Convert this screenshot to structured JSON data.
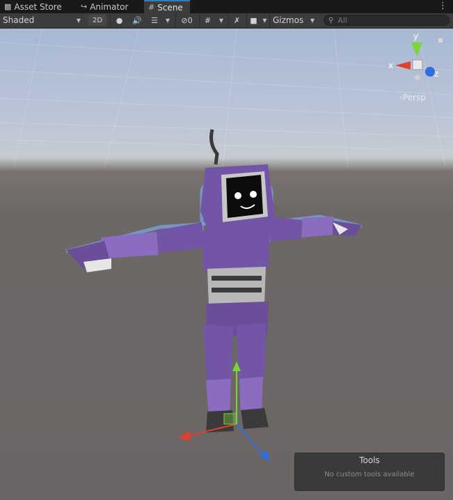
{
  "tabs": [
    {
      "label": "Asset Store",
      "icon": "shopping-bag-icon"
    },
    {
      "label": "Animator",
      "icon": "animator-icon"
    },
    {
      "label": "Scene",
      "icon": "scene-grid-icon",
      "active": true
    }
  ],
  "toolbar": {
    "draw_mode": "Shaded",
    "mode_2d": "2D",
    "hidden_count": "0",
    "gizmos_label": "Gizmos",
    "search_placeholder": "All"
  },
  "scene_gizmo": {
    "axis_y": "y",
    "axis_x": "x",
    "axis_z": "z",
    "projection": "Persp"
  },
  "tools_overlay": {
    "title": "Tools",
    "message": "No custom tools available"
  },
  "colors": {
    "accent": "#3a79bb",
    "robot_purple": "#7355a8",
    "axis_x": "#e0402c",
    "axis_y": "#7ad43c",
    "axis_z": "#2f6ee0"
  }
}
